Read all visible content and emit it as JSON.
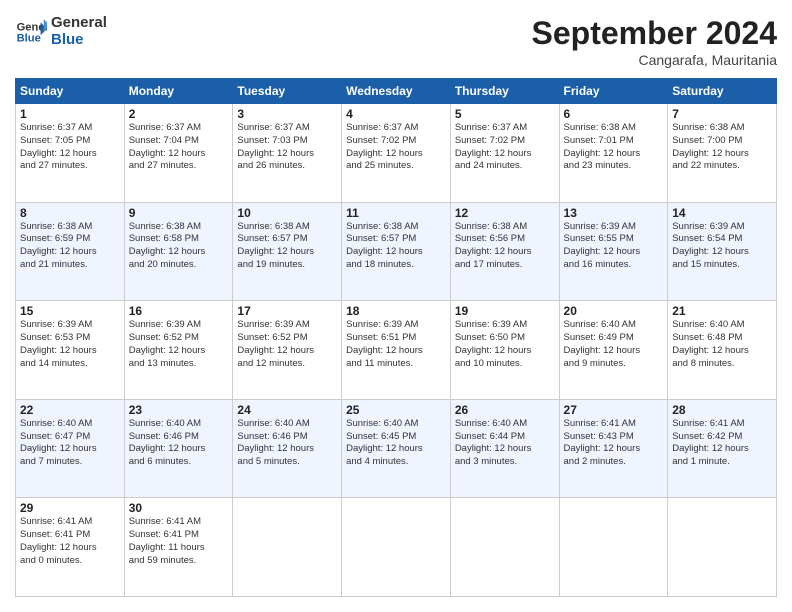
{
  "header": {
    "logo_line1": "General",
    "logo_line2": "Blue",
    "month_title": "September 2024",
    "location": "Cangarafa, Mauritania"
  },
  "days_of_week": [
    "Sunday",
    "Monday",
    "Tuesday",
    "Wednesday",
    "Thursday",
    "Friday",
    "Saturday"
  ],
  "weeks": [
    {
      "days": [
        {
          "num": "1",
          "info": "Sunrise: 6:37 AM\nSunset: 7:05 PM\nDaylight: 12 hours\nand 27 minutes."
        },
        {
          "num": "2",
          "info": "Sunrise: 6:37 AM\nSunset: 7:04 PM\nDaylight: 12 hours\nand 27 minutes."
        },
        {
          "num": "3",
          "info": "Sunrise: 6:37 AM\nSunset: 7:03 PM\nDaylight: 12 hours\nand 26 minutes."
        },
        {
          "num": "4",
          "info": "Sunrise: 6:37 AM\nSunset: 7:02 PM\nDaylight: 12 hours\nand 25 minutes."
        },
        {
          "num": "5",
          "info": "Sunrise: 6:37 AM\nSunset: 7:02 PM\nDaylight: 12 hours\nand 24 minutes."
        },
        {
          "num": "6",
          "info": "Sunrise: 6:38 AM\nSunset: 7:01 PM\nDaylight: 12 hours\nand 23 minutes."
        },
        {
          "num": "7",
          "info": "Sunrise: 6:38 AM\nSunset: 7:00 PM\nDaylight: 12 hours\nand 22 minutes."
        }
      ]
    },
    {
      "days": [
        {
          "num": "8",
          "info": "Sunrise: 6:38 AM\nSunset: 6:59 PM\nDaylight: 12 hours\nand 21 minutes."
        },
        {
          "num": "9",
          "info": "Sunrise: 6:38 AM\nSunset: 6:58 PM\nDaylight: 12 hours\nand 20 minutes."
        },
        {
          "num": "10",
          "info": "Sunrise: 6:38 AM\nSunset: 6:57 PM\nDaylight: 12 hours\nand 19 minutes."
        },
        {
          "num": "11",
          "info": "Sunrise: 6:38 AM\nSunset: 6:57 PM\nDaylight: 12 hours\nand 18 minutes."
        },
        {
          "num": "12",
          "info": "Sunrise: 6:38 AM\nSunset: 6:56 PM\nDaylight: 12 hours\nand 17 minutes."
        },
        {
          "num": "13",
          "info": "Sunrise: 6:39 AM\nSunset: 6:55 PM\nDaylight: 12 hours\nand 16 minutes."
        },
        {
          "num": "14",
          "info": "Sunrise: 6:39 AM\nSunset: 6:54 PM\nDaylight: 12 hours\nand 15 minutes."
        }
      ]
    },
    {
      "days": [
        {
          "num": "15",
          "info": "Sunrise: 6:39 AM\nSunset: 6:53 PM\nDaylight: 12 hours\nand 14 minutes."
        },
        {
          "num": "16",
          "info": "Sunrise: 6:39 AM\nSunset: 6:52 PM\nDaylight: 12 hours\nand 13 minutes."
        },
        {
          "num": "17",
          "info": "Sunrise: 6:39 AM\nSunset: 6:52 PM\nDaylight: 12 hours\nand 12 minutes."
        },
        {
          "num": "18",
          "info": "Sunrise: 6:39 AM\nSunset: 6:51 PM\nDaylight: 12 hours\nand 11 minutes."
        },
        {
          "num": "19",
          "info": "Sunrise: 6:39 AM\nSunset: 6:50 PM\nDaylight: 12 hours\nand 10 minutes."
        },
        {
          "num": "20",
          "info": "Sunrise: 6:40 AM\nSunset: 6:49 PM\nDaylight: 12 hours\nand 9 minutes."
        },
        {
          "num": "21",
          "info": "Sunrise: 6:40 AM\nSunset: 6:48 PM\nDaylight: 12 hours\nand 8 minutes."
        }
      ]
    },
    {
      "days": [
        {
          "num": "22",
          "info": "Sunrise: 6:40 AM\nSunset: 6:47 PM\nDaylight: 12 hours\nand 7 minutes."
        },
        {
          "num": "23",
          "info": "Sunrise: 6:40 AM\nSunset: 6:46 PM\nDaylight: 12 hours\nand 6 minutes."
        },
        {
          "num": "24",
          "info": "Sunrise: 6:40 AM\nSunset: 6:46 PM\nDaylight: 12 hours\nand 5 minutes."
        },
        {
          "num": "25",
          "info": "Sunrise: 6:40 AM\nSunset: 6:45 PM\nDaylight: 12 hours\nand 4 minutes."
        },
        {
          "num": "26",
          "info": "Sunrise: 6:40 AM\nSunset: 6:44 PM\nDaylight: 12 hours\nand 3 minutes."
        },
        {
          "num": "27",
          "info": "Sunrise: 6:41 AM\nSunset: 6:43 PM\nDaylight: 12 hours\nand 2 minutes."
        },
        {
          "num": "28",
          "info": "Sunrise: 6:41 AM\nSunset: 6:42 PM\nDaylight: 12 hours\nand 1 minute."
        }
      ]
    },
    {
      "days": [
        {
          "num": "29",
          "info": "Sunrise: 6:41 AM\nSunset: 6:41 PM\nDaylight: 12 hours\nand 0 minutes."
        },
        {
          "num": "30",
          "info": "Sunrise: 6:41 AM\nSunset: 6:41 PM\nDaylight: 11 hours\nand 59 minutes."
        },
        {
          "num": "",
          "info": ""
        },
        {
          "num": "",
          "info": ""
        },
        {
          "num": "",
          "info": ""
        },
        {
          "num": "",
          "info": ""
        },
        {
          "num": "",
          "info": ""
        }
      ]
    }
  ]
}
